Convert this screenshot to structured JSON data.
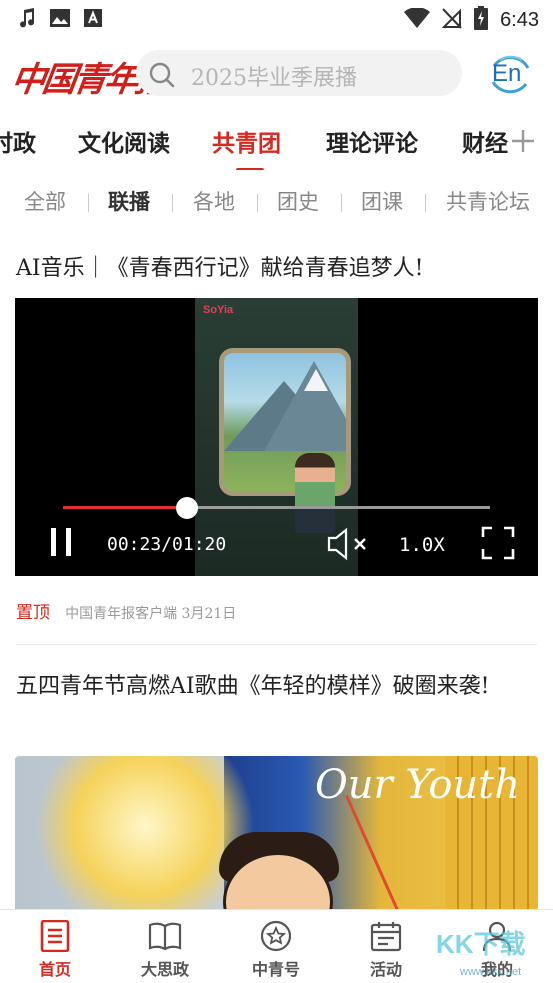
{
  "status_bar": {
    "time": "6:43",
    "left_icons": [
      "music-note-icon",
      "image-icon",
      "text-a-icon"
    ],
    "right_icons": [
      "wifi-icon",
      "no-signal-icon",
      "battery-charging-icon"
    ]
  },
  "header": {
    "logo_text": "中国青年报",
    "search_placeholder": "2025毕业季展播",
    "language_button": "En"
  },
  "channel_tabs": [
    {
      "label": "时政"
    },
    {
      "label": "文化阅读"
    },
    {
      "label": "共青团",
      "active": true
    },
    {
      "label": "理论评论"
    },
    {
      "label": "财经"
    }
  ],
  "sub_tabs": [
    {
      "label": "全部"
    },
    {
      "label": "联播",
      "active": true
    },
    {
      "label": "各地"
    },
    {
      "label": "团史"
    },
    {
      "label": "团课"
    },
    {
      "label": "共青论坛"
    }
  ],
  "articles": [
    {
      "title": "AI音乐｜《青春西行记》献给青春追梦人!",
      "video": {
        "tag": "SoYia",
        "current_time": "00:23",
        "duration": "01:20",
        "time_display": "00:23/01:20",
        "speed": "1.0X",
        "progress_fraction": 0.29
      },
      "pinned_label": "置顶",
      "source": "中国青年报客户端 3月21日"
    },
    {
      "title": "五四青年节高燃AI歌曲《年轻的模样》破圈来袭!",
      "image_text": "Our Youth"
    }
  ],
  "bottom_nav": [
    {
      "label": "首页",
      "icon": "home-list-icon",
      "active": true
    },
    {
      "label": "大思政",
      "icon": "book-icon"
    },
    {
      "label": "中青号",
      "icon": "star-circle-icon"
    },
    {
      "label": "活动",
      "icon": "calendar-icon"
    },
    {
      "label": "我的",
      "icon": "user-icon"
    }
  ],
  "watermark": {
    "text": "KK下载",
    "sub": "www.kkx.net"
  },
  "colors": {
    "accent": "#d8281f",
    "search_bg": "#f2f2f2",
    "en_blue": "#1a6fb8"
  }
}
